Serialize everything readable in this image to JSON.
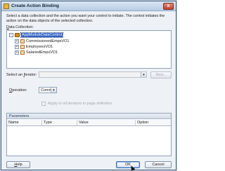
{
  "window": {
    "title": "Create Action Binding",
    "close_glyph": "x"
  },
  "description": "Select a data collection and the action you want your control to initiate. The control initiates the action on the data objects of the selected collection.",
  "data_collection": {
    "label_prefix": "D",
    "label_rest": "ata Collection:",
    "tree": {
      "root": "AppModuleDataControl",
      "children": [
        "CommissionedEmpsVO1",
        "EmployeesVO1",
        "SalariedEmpsVO1"
      ],
      "collapse_glyph": "−",
      "expand_glyph": "+"
    }
  },
  "iterator": {
    "label_before": "Select an ",
    "label_key": "I",
    "label_after": "terator:",
    "value": "",
    "new_button": "New..."
  },
  "operation": {
    "label_key": "O",
    "label_rest": "peration:",
    "value": "Commit"
  },
  "apply_all": {
    "label": "Apply to all iterators in page definition",
    "checked": false
  },
  "parameters": {
    "title": "Parameters",
    "columns": [
      "Name",
      "Type",
      "Value",
      "Option"
    ],
    "rows": []
  },
  "footer": {
    "help_key": "H",
    "help_rest": "elp",
    "ok": "OK",
    "cancel": "Cancel"
  },
  "colors": {
    "selection": "#2f63c4",
    "titlebar": "#b8cde4"
  }
}
